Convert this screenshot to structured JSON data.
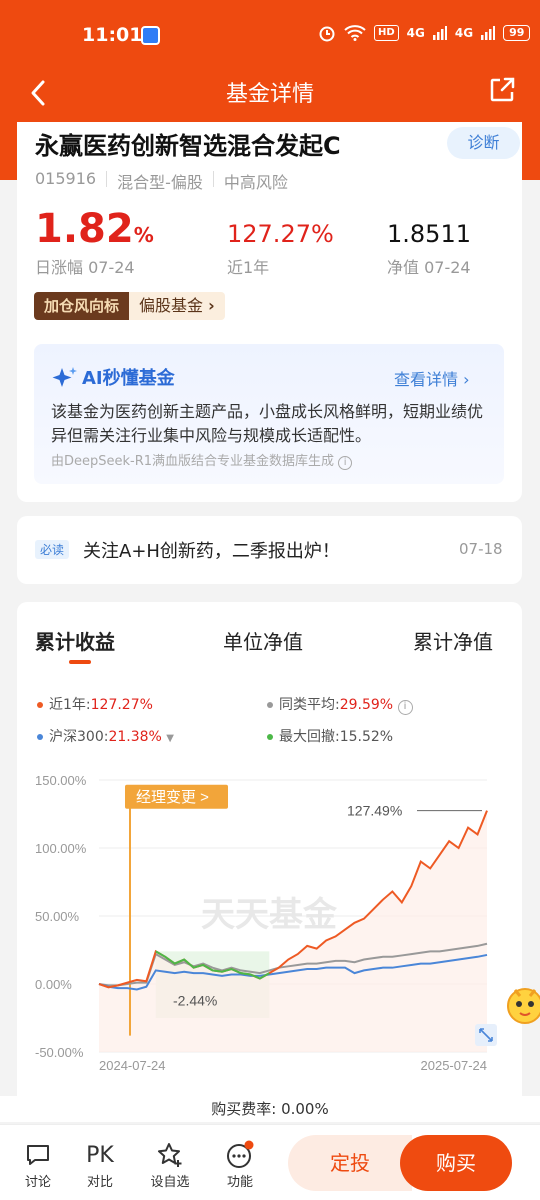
{
  "status": {
    "time": "11:01",
    "battery": "99",
    "hd": "HD",
    "net1": "4G",
    "net2": "4G"
  },
  "nav": {
    "title": "基金详情"
  },
  "fund": {
    "name": "永赢医药创新智选混合发起C",
    "diagnose": "诊断",
    "code": "015916",
    "type": "混合型-偏股",
    "risk": "中高风险",
    "day_change_value": "1.82",
    "day_change_unit": "%",
    "day_change_label": "日涨幅 07-24",
    "year_return": "127.27%",
    "year_return_label": "近1年",
    "nav_value": "1.8511",
    "nav_label": "净值 07-24",
    "tag_dark": "加仓风向标",
    "tag_light": "偏股基金"
  },
  "ai": {
    "title": "AI秒懂基金",
    "link": "查看详情",
    "text": "该基金为医药创新主题产品，小盘成长风格鲜明，短期业绩优异但需关注行业集中风险与规模成长适配性。",
    "footer": "由DeepSeek-R1满血版结合专业基金数据库生成"
  },
  "news": {
    "tag": "必读",
    "text": "关注A+H创新药，二季报出炉！",
    "date": "07-18"
  },
  "tabs": {
    "t1": "累计收益",
    "t2": "单位净值",
    "t3": "累计净值"
  },
  "legend": {
    "fund": "近1年:",
    "fund_val": "127.27%",
    "peer": "同类平均:",
    "peer_val": "29.59%",
    "index": "沪深300:",
    "index_val": "21.38%",
    "drawdown": "最大回撤:",
    "drawdown_val": "15.52%"
  },
  "chart_labels": {
    "manager_change": "经理变更 >",
    "peak": "127.49%",
    "trough": "-2.44%",
    "watermark": "天天基金"
  },
  "chart_data": {
    "type": "line",
    "x_start": "2024-07-24",
    "x_end": "2025-07-24",
    "y_ticks": [
      "150.00%",
      "100.00%",
      "50.00%",
      "0.00%",
      "-50.00%"
    ],
    "ylim": [
      -50,
      150
    ],
    "series": [
      {
        "name": "近1年",
        "color": "#ee5a24",
        "values": [
          0,
          -2.44,
          -1,
          1,
          3,
          2,
          24,
          20,
          15,
          18,
          12,
          14,
          10,
          9,
          11,
          8,
          7,
          4,
          8,
          12,
          18,
          22,
          28,
          26,
          32,
          35,
          40,
          45,
          48,
          55,
          62,
          68,
          60,
          72,
          90,
          85,
          95,
          105,
          100,
          115,
          110,
          127.49
        ]
      },
      {
        "name": "同类平均",
        "color": "#999999",
        "values": [
          0,
          -1,
          -1,
          0,
          1,
          1,
          22,
          18,
          14,
          16,
          13,
          15,
          12,
          10,
          12,
          10,
          9,
          8,
          10,
          12,
          13,
          14,
          15,
          15,
          16,
          17,
          17,
          16,
          18,
          19,
          20,
          20,
          21,
          22,
          23,
          24,
          24,
          25,
          26,
          27,
          28,
          29.59
        ]
      },
      {
        "name": "沪深300",
        "color": "#4a86d8",
        "values": [
          0,
          -2,
          -3,
          -3,
          -4,
          -2,
          10,
          9,
          8,
          9,
          8,
          8,
          7,
          6,
          7,
          7,
          6,
          6,
          7,
          8,
          9,
          10,
          11,
          11,
          12,
          12,
          12,
          8,
          10,
          11,
          12,
          12,
          13,
          14,
          15,
          15,
          16,
          17,
          18,
          19,
          20,
          21.38
        ]
      },
      {
        "name": "最大回撤",
        "color": "#4cb848",
        "values": [
          24,
          20,
          15,
          18,
          12,
          14,
          10,
          9,
          11,
          8,
          7,
          4,
          8
        ]
      }
    ]
  },
  "fee": {
    "text": "购买费率: 0.00%"
  },
  "bottom": {
    "discuss": "讨论",
    "pk": "PK",
    "compare": "对比",
    "watch": "设自选",
    "func": "功能",
    "invest": "定投",
    "buy": "购买"
  }
}
